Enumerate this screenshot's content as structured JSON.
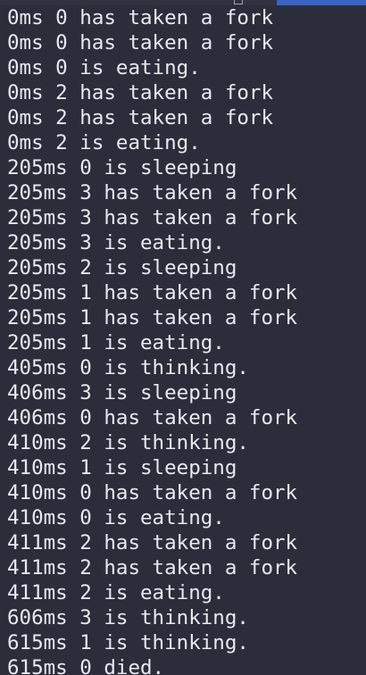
{
  "terminal": {
    "colors": {
      "background": "#2b2d3a",
      "text": "#e8e9ef",
      "top_strip_highlight": "#3a63c7"
    },
    "lines": [
      "0ms 0 has taken a fork",
      "0ms 0 has taken a fork",
      "0ms 0 is eating.",
      "0ms 2 has taken a fork",
      "0ms 2 has taken a fork",
      "0ms 2 is eating.",
      "205ms 0 is sleeping",
      "205ms 3 has taken a fork",
      "205ms 3 has taken a fork",
      "205ms 3 is eating.",
      "205ms 2 is sleeping",
      "205ms 1 has taken a fork",
      "205ms 1 has taken a fork",
      "205ms 1 is eating.",
      "405ms 0 is thinking.",
      "406ms 3 is sleeping",
      "406ms 0 has taken a fork",
      "410ms 2 is thinking.",
      "410ms 1 is sleeping",
      "410ms 0 has taken a fork",
      "410ms 0 is eating.",
      "411ms 2 has taken a fork",
      "411ms 2 has taken a fork",
      "411ms 2 is eating.",
      "606ms 3 is thinking.",
      "615ms 1 is thinking.",
      "615ms 0 died."
    ]
  }
}
